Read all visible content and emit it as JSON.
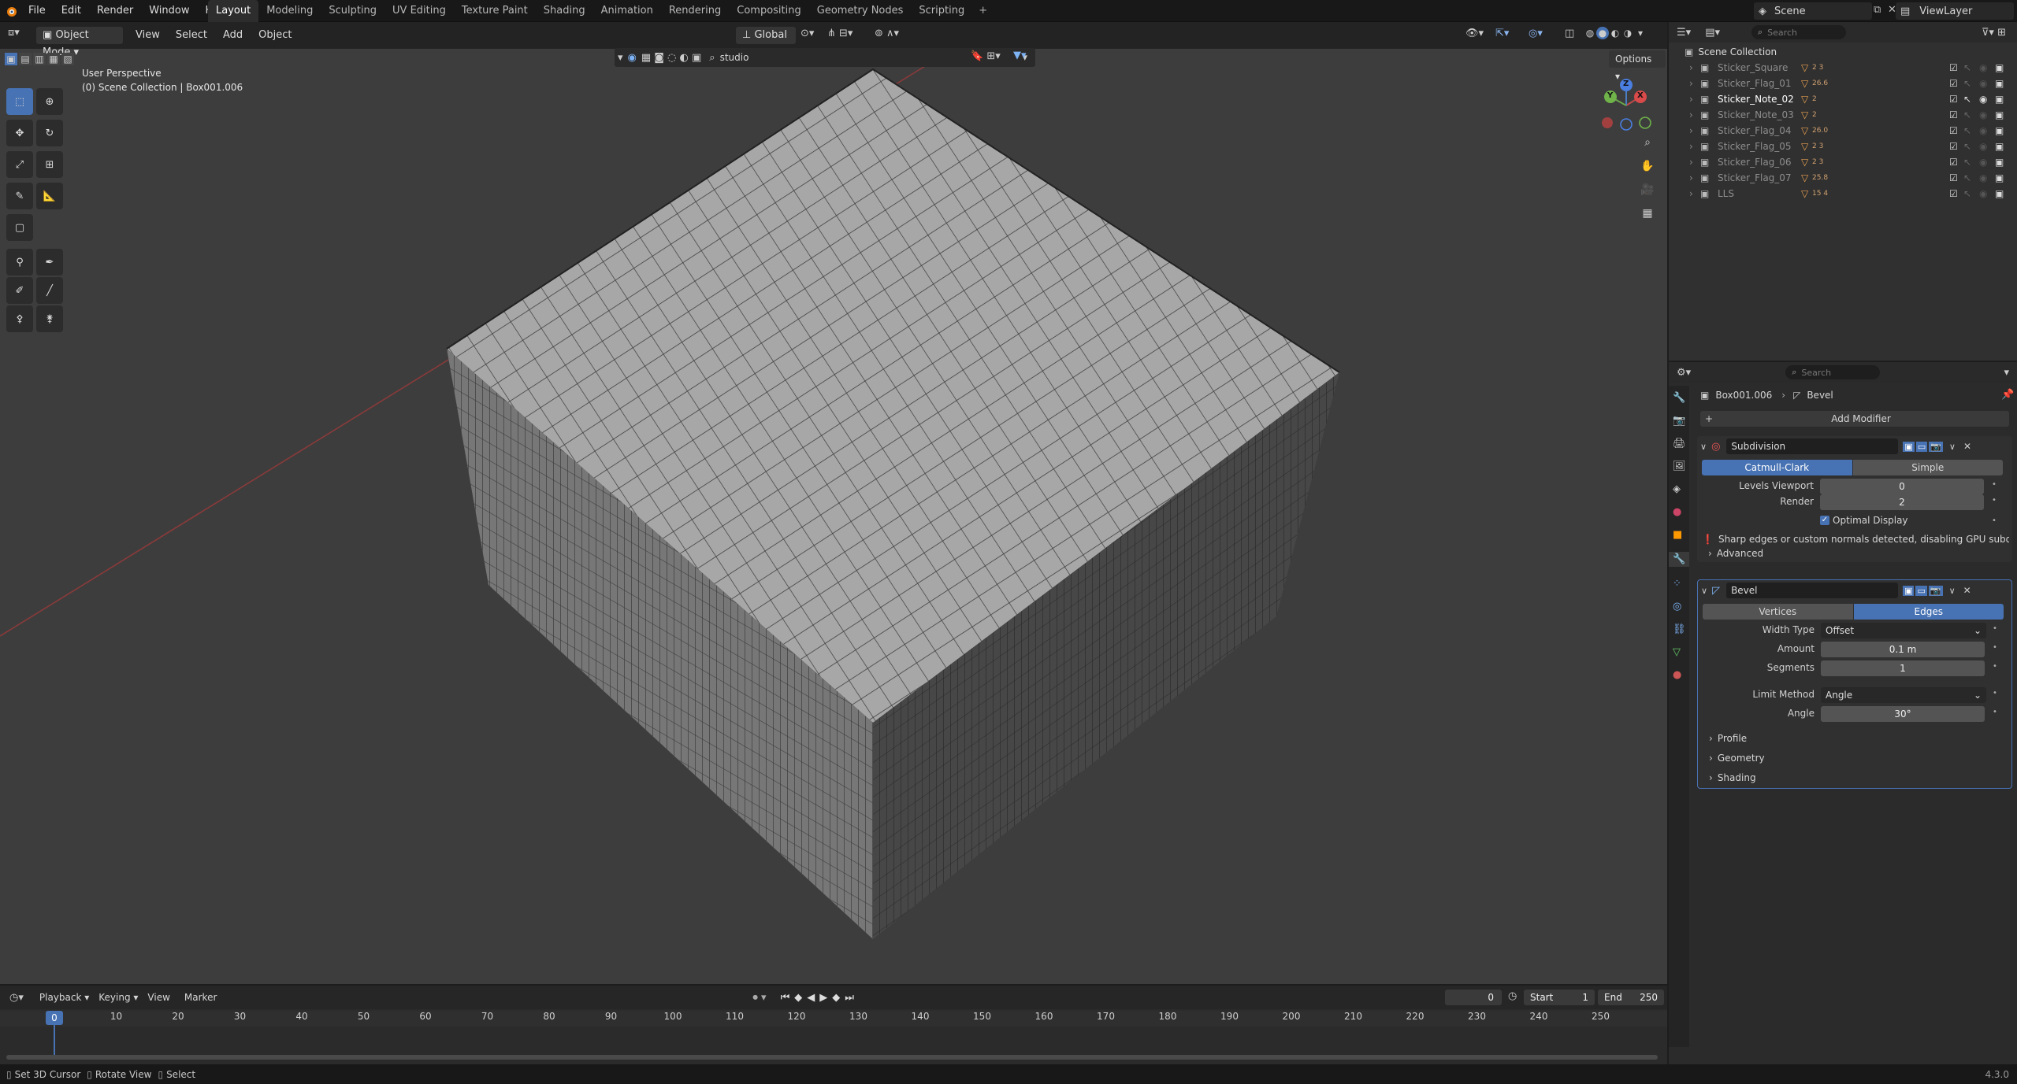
{
  "topbar": {
    "menus": [
      "File",
      "Edit",
      "Render",
      "Window",
      "Help"
    ],
    "workspaces": [
      "Layout",
      "Modeling",
      "Sculpting",
      "UV Editing",
      "Texture Paint",
      "Shading",
      "Animation",
      "Rendering",
      "Compositing",
      "Geometry Nodes",
      "Scripting"
    ],
    "active_workspace": "Layout",
    "add_tab": "+",
    "scene_label": "Scene",
    "viewlayer_label": "ViewLayer"
  },
  "viewport": {
    "mode": "Object Mode",
    "menus": [
      "View",
      "Select",
      "Add",
      "Object"
    ],
    "transform_orientation": "Global",
    "shading_search": "studio",
    "options_label": "Options",
    "overlay_title": "User Perspective",
    "overlay_subtitle": "(0) Scene Collection | Box001.006",
    "gizmo": {
      "x": "X",
      "y": "Y",
      "z": "Z"
    }
  },
  "outliner": {
    "search_placeholder": "Search",
    "root": "Scene Collection",
    "items": [
      {
        "name": "Sticker_Square",
        "badge": "2  3"
      },
      {
        "name": "Sticker_Flag_01",
        "badge": "26.6"
      },
      {
        "name": "Sticker_Note_02",
        "badge": "2"
      },
      {
        "name": "Sticker_Note_03",
        "badge": "2"
      },
      {
        "name": "Sticker_Flag_04",
        "badge": "26.0"
      },
      {
        "name": "Sticker_Flag_05",
        "badge": "2  3"
      },
      {
        "name": "Sticker_Flag_06",
        "badge": "2  3"
      },
      {
        "name": "Sticker_Flag_07",
        "badge": "25.8"
      },
      {
        "name": "LLS",
        "badge": "15  4"
      }
    ]
  },
  "properties": {
    "search_placeholder": "Search",
    "breadcrumb_object": "Box001.006",
    "breadcrumb_modifier": "Bevel",
    "add_modifier": "Add Modifier",
    "subdivision": {
      "name": "Subdivision",
      "type_a": "Catmull-Clark",
      "type_b": "Simple",
      "levels_viewport_label": "Levels Viewport",
      "levels_viewport": "0",
      "render_label": "Render",
      "render": "2",
      "optimal_display": "Optimal Display",
      "warning": "Sharp edges or custom normals detected, disabling GPU subdivi...",
      "advanced": "Advanced"
    },
    "bevel": {
      "name": "Bevel",
      "tab_a": "Vertices",
      "tab_b": "Edges",
      "width_type_label": "Width Type",
      "width_type": "Offset",
      "amount_label": "Amount",
      "amount": "0.1 m",
      "segments_label": "Segments",
      "segments": "1",
      "limit_method_label": "Limit Method",
      "limit_method": "Angle",
      "angle_label": "Angle",
      "angle": "30°",
      "sections": [
        "Profile",
        "Geometry",
        "Shading"
      ]
    }
  },
  "timeline": {
    "menus": [
      "Playback",
      "Keying",
      "View",
      "Marker"
    ],
    "current_frame": "0",
    "start_label": "Start",
    "start": "1",
    "end_label": "End",
    "end": "250",
    "ruler": [
      "0",
      "10",
      "20",
      "30",
      "40",
      "50",
      "60",
      "70",
      "80",
      "90",
      "100",
      "110",
      "120",
      "130",
      "140",
      "150",
      "160",
      "170",
      "180",
      "190",
      "200",
      "210",
      "220",
      "230",
      "240",
      "250"
    ]
  },
  "statusbar": {
    "hints": [
      "Set 3D Cursor",
      "Rotate View",
      "Select"
    ],
    "version": "4.3.0"
  },
  "colors": {
    "accent": "#4772b3",
    "viewport_bg": "#3d3d3d",
    "panel_bg": "#303030"
  }
}
